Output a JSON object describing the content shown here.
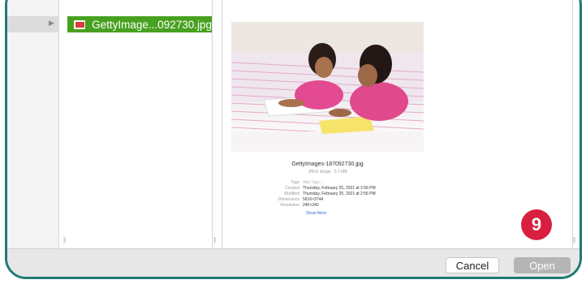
{
  "file_browser": {
    "selected_file": "GettyImage...092730.jpg"
  },
  "preview": {
    "file_name": "GettyImages-187092730.jpg",
    "subtitle": "JPEG image - 5.7 MB",
    "metadata": [
      {
        "key": "Tags",
        "value": "Add Tags...",
        "muted": true
      },
      {
        "key": "Created",
        "value": "Thursday, February 25, 2021 at 2:56 PM"
      },
      {
        "key": "Modified",
        "value": "Thursday, February 25, 2021 at 2:56 PM"
      },
      {
        "key": "Dimensions",
        "value": "5616×3744"
      },
      {
        "key": "Resolution",
        "value": "240×240"
      }
    ],
    "show_more": "Show More"
  },
  "footer": {
    "cancel_label": "Cancel",
    "open_label": "Open"
  },
  "step_badge": "9",
  "icons": {
    "expand": "chevron-right-icon",
    "file": "image-file-icon",
    "resize": "column-resize-icon"
  },
  "colors": {
    "selection": "#47a11f",
    "frame": "#1f7a72",
    "badge": "#d81f3f"
  }
}
